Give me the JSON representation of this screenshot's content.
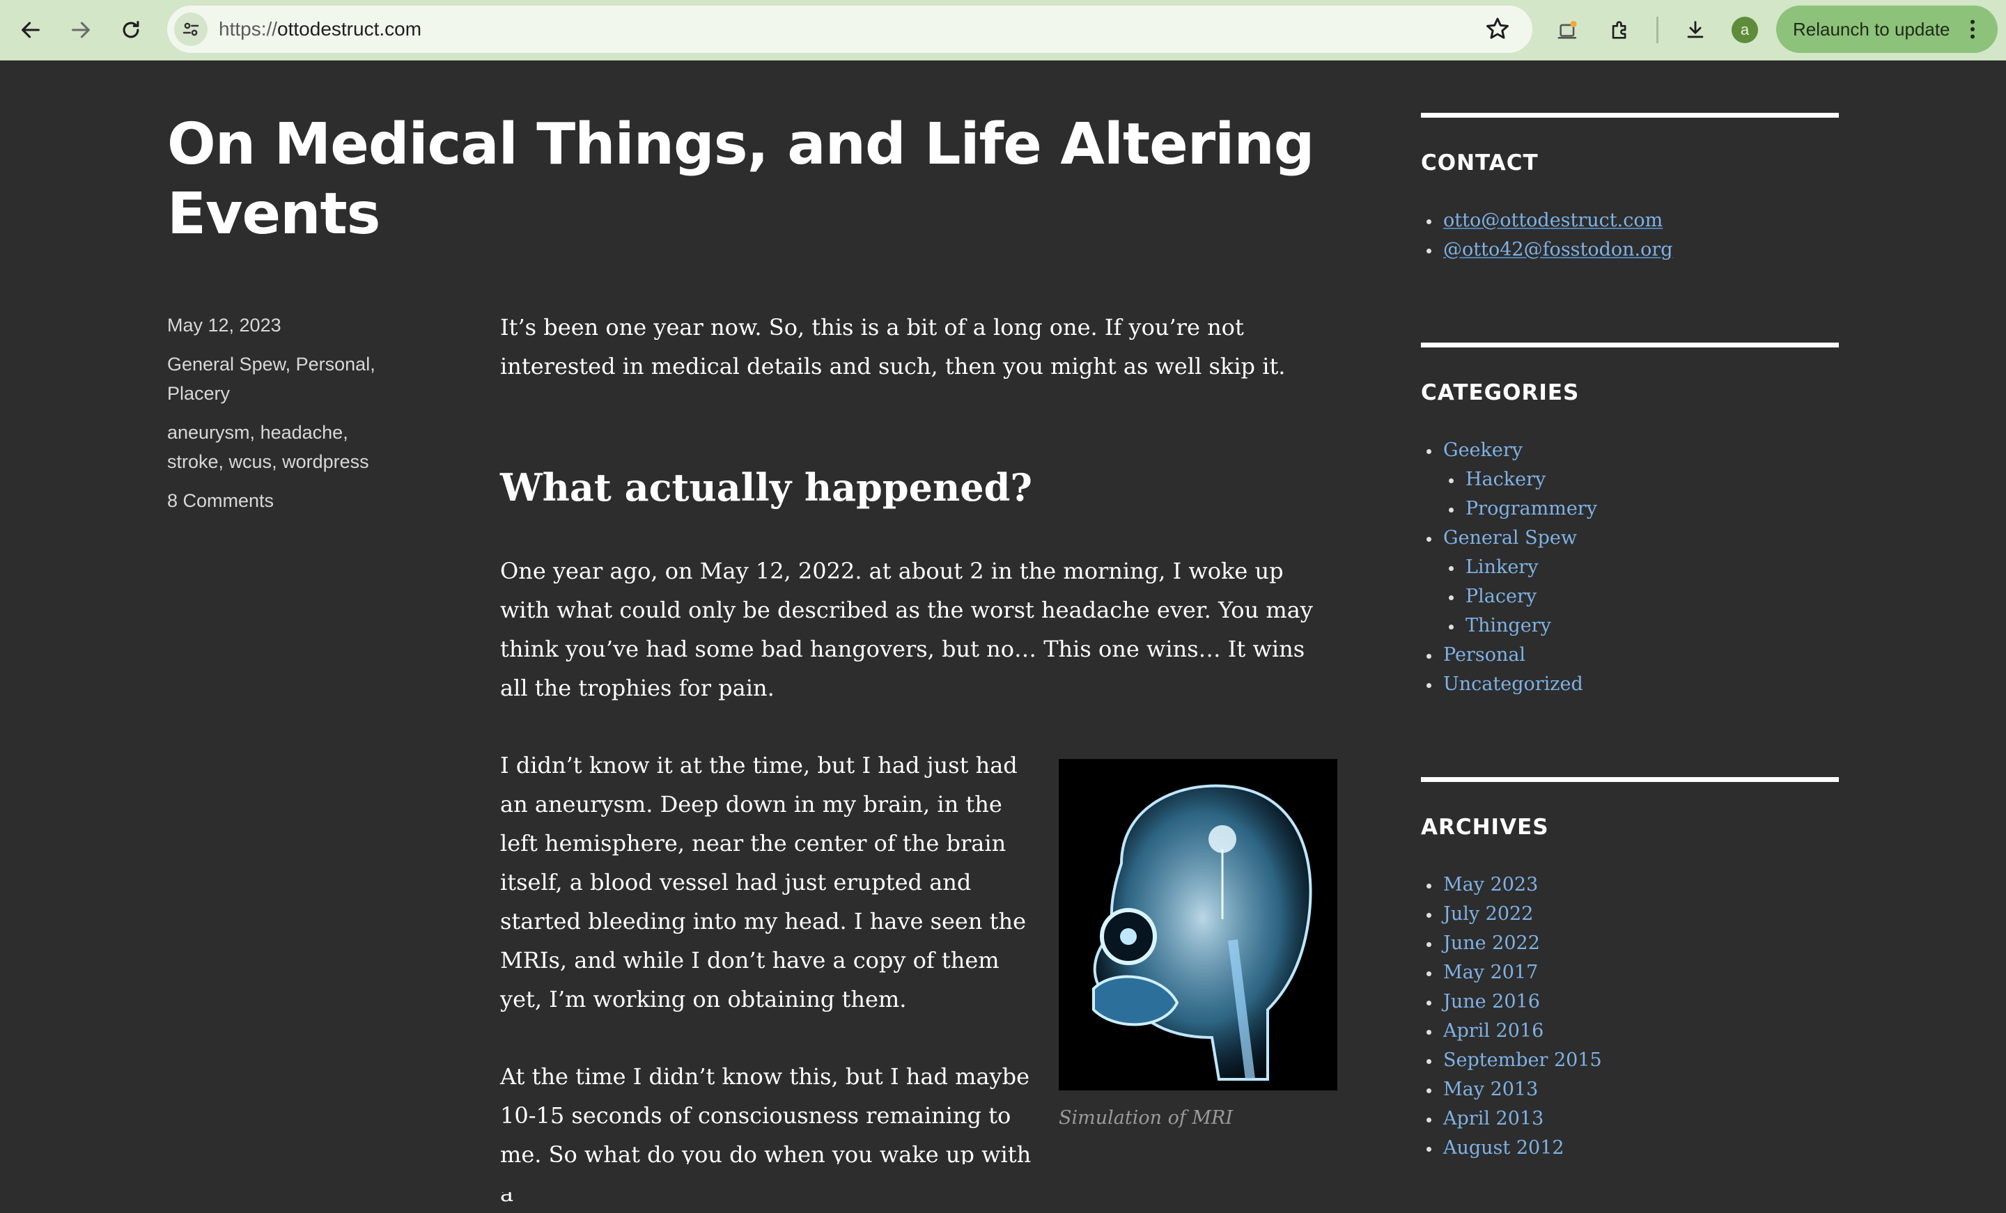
{
  "browser": {
    "url_scheme": "https://",
    "url_host": "ottodestruct.com",
    "profile_initial": "a",
    "relaunch_label": "Relaunch to update"
  },
  "post": {
    "title": "On Medical Things, and Life Altering Events",
    "date": "May 12, 2023",
    "categories": [
      "General Spew",
      "Personal",
      "Placery"
    ],
    "tags": [
      "aneurysm",
      "headache",
      "stroke",
      "wcus",
      "wordpress"
    ],
    "comments": "8 Comments",
    "intro": "It’s been one year now. So, this is a bit of a long one. If you’re not interested in medical details and such, then you might as well skip it.",
    "heading": "What actually happened?",
    "p1": "One year ago, on May 12, 2022. at about 2 in the morning, I woke up with what could only be described as the worst headache ever. You may think you’ve had some bad hangovers, but no… This one wins… It wins all the trophies for pain.",
    "p2": "I didn’t know it at the time, but I had just had an aneurysm. Deep down in my brain, in the left hemisphere, near the center of the brain itself, a blood vessel had just erupted and started bleeding into my head. I have seen the MRIs, and while I don’t have a copy of them yet, I’m working on obtaining them.",
    "p3": "At the time I didn’t know this, but I had maybe 10-15 seconds of consciousness remaining to me. So what do you do when you wake up with a",
    "figure_caption": "Simulation of MRI"
  },
  "sidebar": {
    "contact": {
      "title": "CONTACT",
      "items": [
        "otto@ottodestruct.com",
        "@otto42@fosstodon.org"
      ]
    },
    "categories": {
      "title": "CATEGORIES",
      "items": [
        {
          "label": "Geekery",
          "level": 0
        },
        {
          "label": "Hackery",
          "level": 1
        },
        {
          "label": "Programmery",
          "level": 1
        },
        {
          "label": "General Spew",
          "level": 0
        },
        {
          "label": "Linkery",
          "level": 1
        },
        {
          "label": "Placery",
          "level": 1
        },
        {
          "label": "Thingery",
          "level": 1
        },
        {
          "label": "Personal",
          "level": 0
        },
        {
          "label": "Uncategorized",
          "level": 0
        }
      ]
    },
    "archives": {
      "title": "ARCHIVES",
      "items": [
        "May 2023",
        "July 2022",
        "June 2022",
        "May 2017",
        "June 2016",
        "April 2016",
        "September 2015",
        "May 2013",
        "April 2013",
        "August 2012"
      ]
    }
  },
  "colors": {
    "page_background": "#2d2d2d",
    "toolbar_background": "#d3e6c8",
    "link": "#7fb2e5",
    "relaunch_button": "#8dc27a"
  },
  "icons": [
    "back-arrow-icon",
    "forward-arrow-icon",
    "reload-icon",
    "site-info-icon",
    "star-icon",
    "notification-icon",
    "extensions-icon",
    "download-icon",
    "more-vert-icon",
    "xray-head-image"
  ]
}
